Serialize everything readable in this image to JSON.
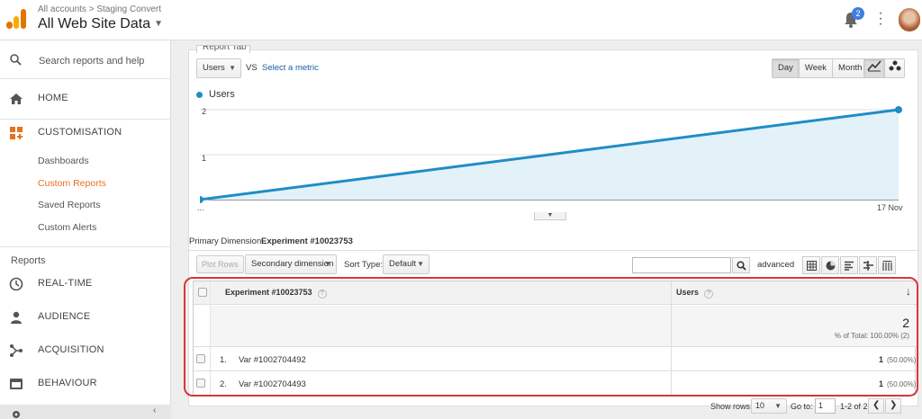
{
  "header": {
    "breadcrumb": "All accounts > Staging Convert",
    "property": "All Web Site Data",
    "notification_count": "2"
  },
  "sidebar": {
    "search_placeholder": "Search reports and help",
    "home": "HOME",
    "customisation": "CUSTOMISATION",
    "custom_items": [
      "Dashboards",
      "Custom Reports",
      "Saved Reports",
      "Custom Alerts"
    ],
    "reports_heading": "Reports",
    "report_items": [
      "REAL-TIME",
      "AUDIENCE",
      "ACQUISITION",
      "BEHAVIOUR"
    ]
  },
  "report": {
    "tab_label": "Report Tab",
    "metric_select": "Users",
    "vs": "VS",
    "select_metric": "Select a metric",
    "granularity": [
      "Day",
      "Week",
      "Month"
    ],
    "active_granularity": "Day"
  },
  "chart_data": {
    "type": "area",
    "series": [
      {
        "name": "Users",
        "values": [
          0,
          2
        ]
      }
    ],
    "x": [
      "...",
      "17 Nov"
    ],
    "yticks": [
      "1",
      "2"
    ],
    "ylim": [
      0,
      2
    ],
    "color": "#1f8dc6",
    "fill": "#e3f1f9"
  },
  "primary_dimension": {
    "label": "Primary Dimension:",
    "value": "Experiment #10023753"
  },
  "toolbar": {
    "plot_rows": "Plot Rows",
    "secondary_dimension": "Secondary dimension",
    "sort_type_label": "Sort Type:",
    "sort_type": "Default",
    "advanced": "advanced"
  },
  "table": {
    "col_dimension": "Experiment #10023753",
    "col_users": "Users",
    "total_value": "2",
    "total_note": "% of Total: 100.00% (2)",
    "rows": [
      {
        "index": "1.",
        "name": "Var #1002704492",
        "users": "1",
        "pct": "(50.00%)"
      },
      {
        "index": "2.",
        "name": "Var #1002704493",
        "users": "1",
        "pct": "(50.00%)"
      }
    ]
  },
  "footer": {
    "show_rows_label": "Show rows:",
    "show_rows": "10",
    "goto_label": "Go to:",
    "goto_value": "1",
    "range": "1-2 of 2"
  },
  "colors": {
    "accent": "#e8711c",
    "highlight": "#d9363e",
    "link": "#1a5ea8"
  }
}
